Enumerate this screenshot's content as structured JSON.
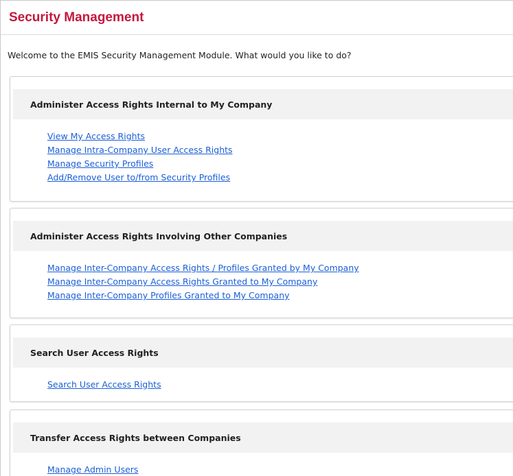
{
  "page": {
    "title": "Security Management",
    "welcome": "Welcome to the EMIS Security Management Module. What would you like to do?"
  },
  "sections": [
    {
      "heading": "Administer Access Rights Internal to My Company",
      "links": [
        "View My Access Rights",
        "Manage Intra-Company User Access Rights",
        "Manage Security Profiles",
        "Add/Remove User to/from Security Profiles"
      ]
    },
    {
      "heading": "Administer Access Rights Involving Other Companies",
      "links": [
        "Manage Inter-Company Access Rights / Profiles Granted by My Company",
        "Manage Inter-Company Access Rights Granted to My Company",
        "Manage Inter-Company Profiles Granted to My Company"
      ]
    },
    {
      "heading": "Search User Access Rights",
      "links": [
        "Search User Access Rights"
      ]
    },
    {
      "heading": "Transfer Access Rights between Companies",
      "links": [
        "Manage Admin Users"
      ]
    }
  ],
  "colors": {
    "title": "#c4183c",
    "link": "#1a5ed8",
    "header_bg": "#f2f2f2"
  }
}
